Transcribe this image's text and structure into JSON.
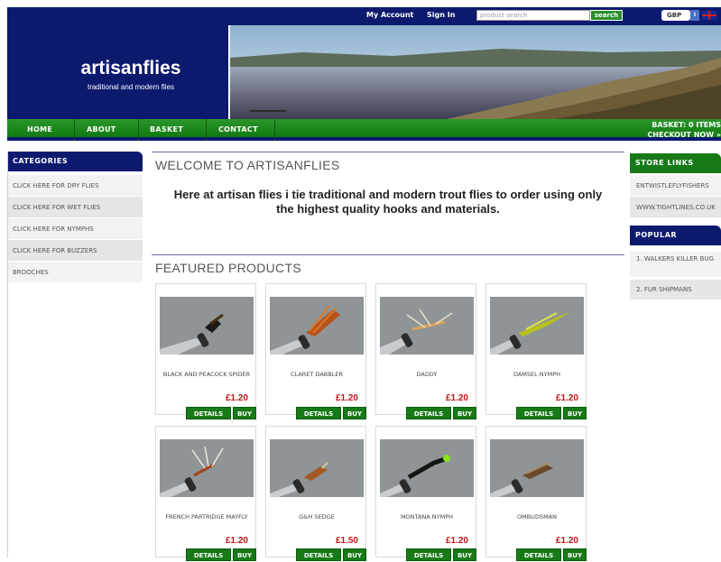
{
  "topbar": {
    "my_account": "My Account",
    "sign_in": "Sign In",
    "search_placeholder": "product search",
    "search_button": "search",
    "currency": "GBP"
  },
  "header": {
    "site_title": "artisanflies",
    "tagline": "traditional and modern flies"
  },
  "nav": {
    "items": [
      "HOME",
      "ABOUT",
      "BASKET",
      "CONTACT"
    ],
    "basket_summary": "BASKET: 0 ITEMS",
    "checkout": "CHECKOUT NOW »"
  },
  "categories": {
    "heading": "CATEGORIES",
    "items": [
      "CLICK HERE FOR DRY FLIES",
      "CLICK HERE FOR WET FLIES",
      "CLICK HERE FOR NYMPHS",
      "CLICK HERE FOR BUZZERS",
      "BROOCHES"
    ]
  },
  "welcome": {
    "title": "WELCOME TO ARTISANFLIES",
    "text": "Here at artisan flies i tie traditional and modern trout flies to order using only the highest quality hooks and materials."
  },
  "featured": {
    "title": "FEATURED PRODUCTS",
    "details_label": "DETAILS",
    "buy_label": "BUY",
    "products": [
      {
        "name": "BLACK AND PEACOCK SPIDER",
        "price": "£1.20"
      },
      {
        "name": "CLARET DABBLER",
        "price": "£1.20"
      },
      {
        "name": "DADDY",
        "price": "£1.20"
      },
      {
        "name": "DAMSEL NYMPH",
        "price": "£1.20"
      },
      {
        "name": "FRENCH PARTRIDGE MAYFLY",
        "price": "£1.20"
      },
      {
        "name": "G&H SEDGE",
        "price": "£1.50"
      },
      {
        "name": "MONTANA NYMPH",
        "price": "£1.20"
      },
      {
        "name": "OMBUDSMAN",
        "price": "£1.20"
      }
    ]
  },
  "store_links": {
    "heading": "STORE LINKS",
    "items": [
      "ENTWISTLEFLYFISHERS",
      "WWW.TIGHTLINES.CO.UK"
    ]
  },
  "popular": {
    "heading": "POPULAR",
    "items": [
      "1. WALKERS KILLER BUG",
      "2. FUR SHIPMANS"
    ]
  },
  "colors": {
    "navy": "#0c1a6e",
    "green": "#177a17",
    "price_red": "#c21515"
  }
}
